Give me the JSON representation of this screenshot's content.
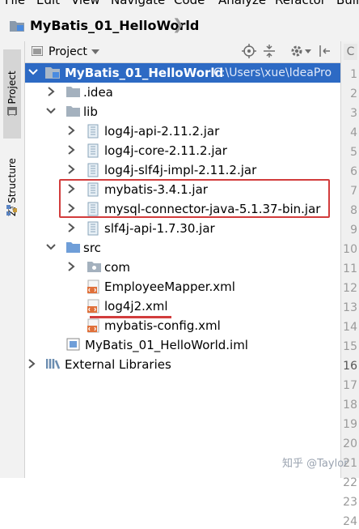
{
  "menubar": {
    "items": [
      "File",
      "Edit",
      "View",
      "Navigate",
      "Code",
      "Analyze",
      "Refactor",
      "Build"
    ]
  },
  "navbar": {
    "project_name": "MyBatis_01_HelloWorld"
  },
  "side_strip": {
    "project_tab": "1: Project",
    "structure_tab": "Z: Structure"
  },
  "toolbar": {
    "view_label": "Project"
  },
  "tree": {
    "root": {
      "name": "MyBatis_01_HelloWorld",
      "path": "C:\\Users\\xue\\IdeaPro"
    },
    "idea": ".idea",
    "lib": "lib",
    "jars": [
      "log4j-api-2.11.2.jar",
      "log4j-core-2.11.2.jar",
      "log4j-slf4j-impl-2.11.2.jar",
      "mybatis-3.4.1.jar",
      "mysql-connector-java-5.1.37-bin.jar",
      "slf4j-api-1.7.30.jar"
    ],
    "src": "src",
    "com": "com",
    "xml_files": [
      "EmployeeMapper.xml",
      "log4j2.xml",
      "mybatis-config.xml"
    ],
    "iml": "MyBatis_01_HelloWorld.iml",
    "external_libraries": "External Libraries"
  },
  "gutter": {
    "line_numbers": [
      "1",
      "2",
      "3",
      "4",
      "5",
      "6",
      "7",
      "8",
      "9",
      "10",
      "11",
      "12",
      "13",
      "14",
      "15",
      "16",
      "17",
      "18",
      "19",
      "20",
      "21",
      "22",
      "23",
      "24"
    ],
    "current_line": "16",
    "top_tab": "C"
  },
  "watermark": "知乎 @Taylor",
  "colors": {
    "selection": "#2d6ac4",
    "annotation": "#d23c3c"
  }
}
